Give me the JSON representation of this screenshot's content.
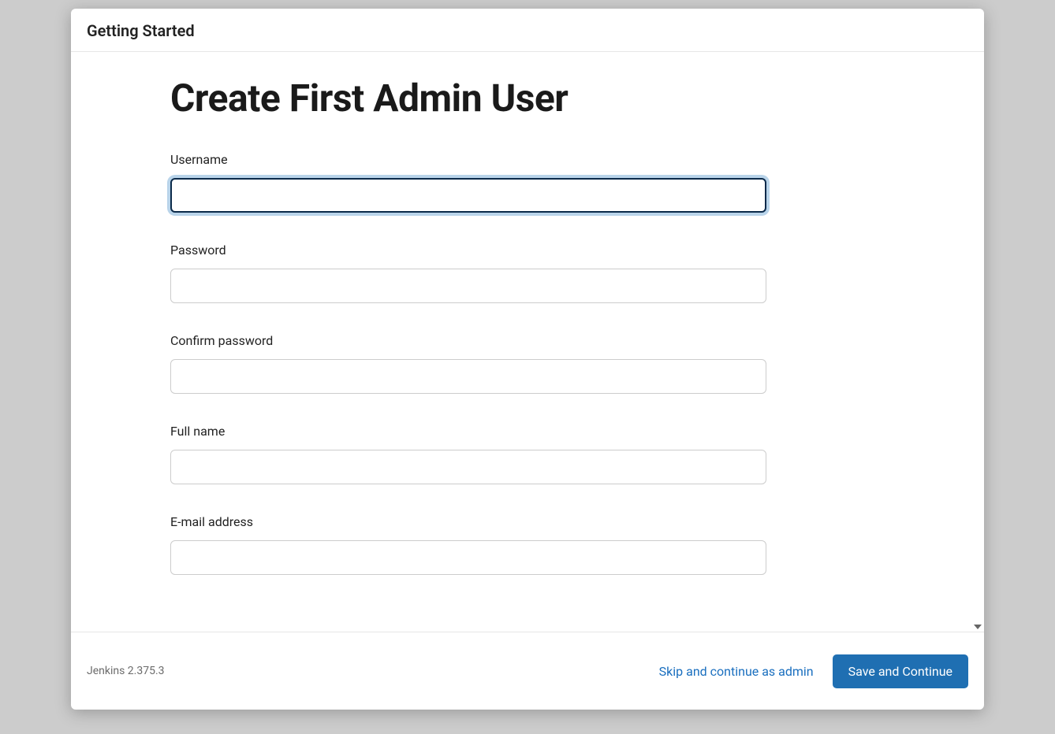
{
  "header": {
    "title": "Getting Started"
  },
  "page": {
    "title": "Create First Admin User"
  },
  "form": {
    "username": {
      "label": "Username",
      "value": ""
    },
    "password": {
      "label": "Password",
      "value": ""
    },
    "confirm": {
      "label": "Confirm password",
      "value": ""
    },
    "fullname": {
      "label": "Full name",
      "value": ""
    },
    "email": {
      "label": "E-mail address",
      "value": ""
    }
  },
  "footer": {
    "version": "Jenkins 2.375.3",
    "skip_label": "Skip and continue as admin",
    "save_label": "Save and Continue"
  }
}
